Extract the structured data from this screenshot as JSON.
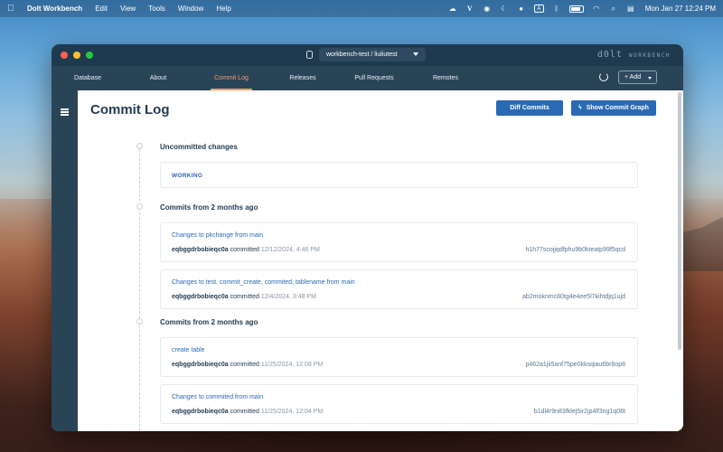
{
  "menubar": {
    "app_name": "Dolt Workbench",
    "menus": [
      "Edit",
      "View",
      "Tools",
      "Window",
      "Help"
    ],
    "datetime": "Mon Jan 27  12:24 PM",
    "status_a": "A"
  },
  "window": {
    "branch_select": "workbench-test / liuliutest",
    "logo": "d0lt",
    "logo_sub": "WORKBENCH"
  },
  "nav": {
    "tabs": [
      "Database",
      "About",
      "Commit Log",
      "Releases",
      "Pull Requests",
      "Remotes"
    ],
    "active_tab": "Commit Log",
    "add_label": "+ Add"
  },
  "page": {
    "title": "Commit Log",
    "diff_button": "Diff Commits",
    "graph_button": "Show Commit Graph"
  },
  "uncommitted": {
    "heading": "Uncommitted changes",
    "label": "WORKING"
  },
  "groups": [
    {
      "heading": "Commits from 2 months ago",
      "commits": [
        {
          "message": "Changes to pkchange from main",
          "author": "eqbggdrbobieqc0a",
          "verb": "committed",
          "date": "12/12/2024, 4:46 PM",
          "hash": "h1h77scojjqdfphu9b0kteatp99f5qcd"
        },
        {
          "message": "Changes to test, commit_create, commited, tablename from main",
          "author": "eqbggdrbobieqc0a",
          "verb": "committed",
          "date": "12/4/2024, 3:48 PM",
          "hash": "ab2moknmc80tg4e4ee5l7kihtdjq1ujd"
        }
      ]
    },
    {
      "heading": "Commits from 2 months ago",
      "commits": [
        {
          "message": "create table",
          "author": "eqbggdrbobieqc0a",
          "verb": "committed",
          "date": "11/25/2024, 12:08 PM",
          "hash": "p462a1jii5anf75pe0kksqiau6br8op8"
        },
        {
          "message": "Changes to commited from main",
          "author": "eqbggdrbobieqc0a",
          "verb": "committed",
          "date": "11/25/2024, 12:04 PM",
          "hash": "b1dl4r9n83fklej5ir2jp4lf3ng1q08t"
        }
      ]
    }
  ]
}
